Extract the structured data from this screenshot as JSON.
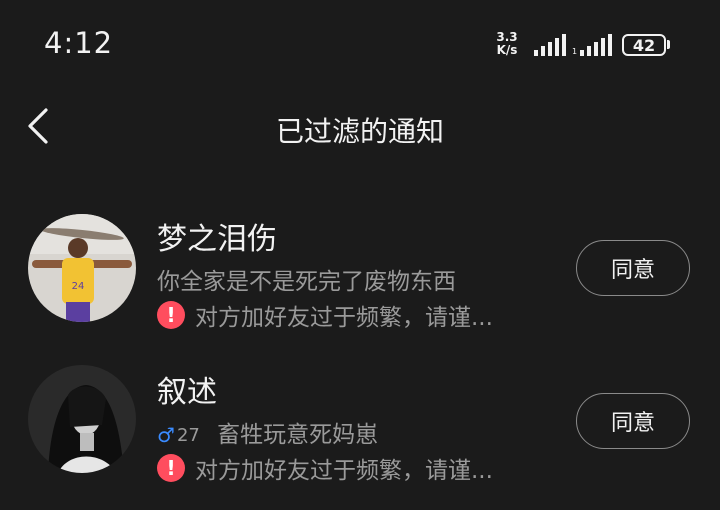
{
  "status_bar": {
    "time": "4:12",
    "net_speed_value": "3.3",
    "net_speed_unit": "K/s",
    "battery": "42"
  },
  "header": {
    "title": "已过滤的通知"
  },
  "notifications": [
    {
      "name": "梦之泪伤",
      "message": "你全家是不是死完了废物东西",
      "warning": "对方加好友过于频繁，请谨...",
      "button": "同意"
    },
    {
      "name": "叙述",
      "gender_symbol": "♂",
      "age": "27",
      "message": "畜牲玩意死妈崽",
      "warning": "对方加好友过于频繁，请谨...",
      "button": "同意"
    }
  ],
  "icons": {
    "back": "chevron-left-icon",
    "warning": "exclamation-icon",
    "gender": "male-icon"
  },
  "colors": {
    "background": "#1b1b1b",
    "warning": "#ff4d5e",
    "male": "#3a8bff"
  }
}
